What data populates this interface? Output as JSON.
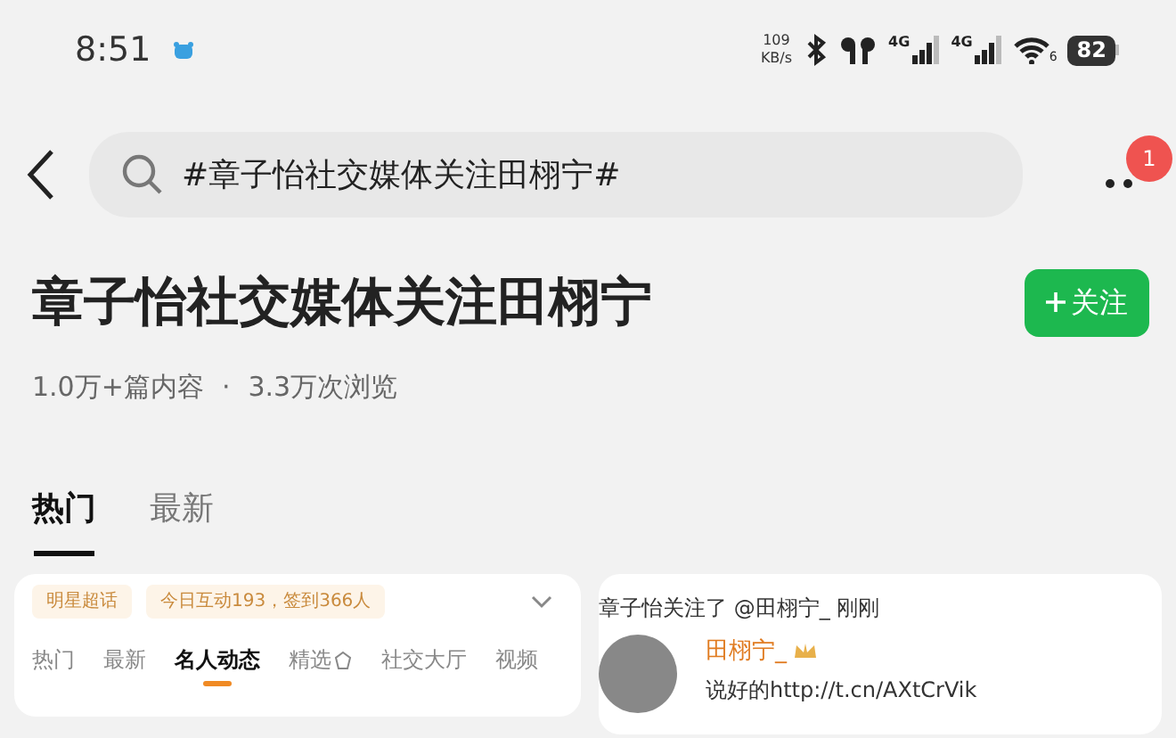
{
  "status_bar": {
    "time": "8:51",
    "net_speed": "109",
    "net_unit": "KB/s",
    "signal_labels": [
      "4G",
      "4G"
    ],
    "wifi_label": "6",
    "battery": "82"
  },
  "search": {
    "query": "#章子怡社交媒体关注田栩宁#",
    "badge": "1"
  },
  "topic": {
    "title": "章子怡社交媒体关注田栩宁",
    "follow_button": "关注",
    "stats": [
      "1.0万+篇内容",
      "·",
      "3.3万次浏览"
    ]
  },
  "tabs": [
    {
      "label": "热门",
      "selected": true
    },
    {
      "label": "最新",
      "selected": false
    }
  ],
  "left_card": {
    "tags": [
      "明星超话",
      "今日互动193，签到366人"
    ],
    "subtabs": [
      {
        "label": "热门",
        "selected": false
      },
      {
        "label": "最新",
        "selected": false
      },
      {
        "label": "名人动态",
        "selected": true
      },
      {
        "label": "精选",
        "selected": false,
        "kind": "icon"
      },
      {
        "label": "社交大厅",
        "selected": false
      },
      {
        "label": "视频",
        "selected": false
      }
    ]
  },
  "right_card": {
    "headline": "章子怡关注了 @田栩宁_ 刚刚",
    "user_name": "田栩宁_",
    "post": "说好的http://t.cn/AXtCrVik"
  }
}
